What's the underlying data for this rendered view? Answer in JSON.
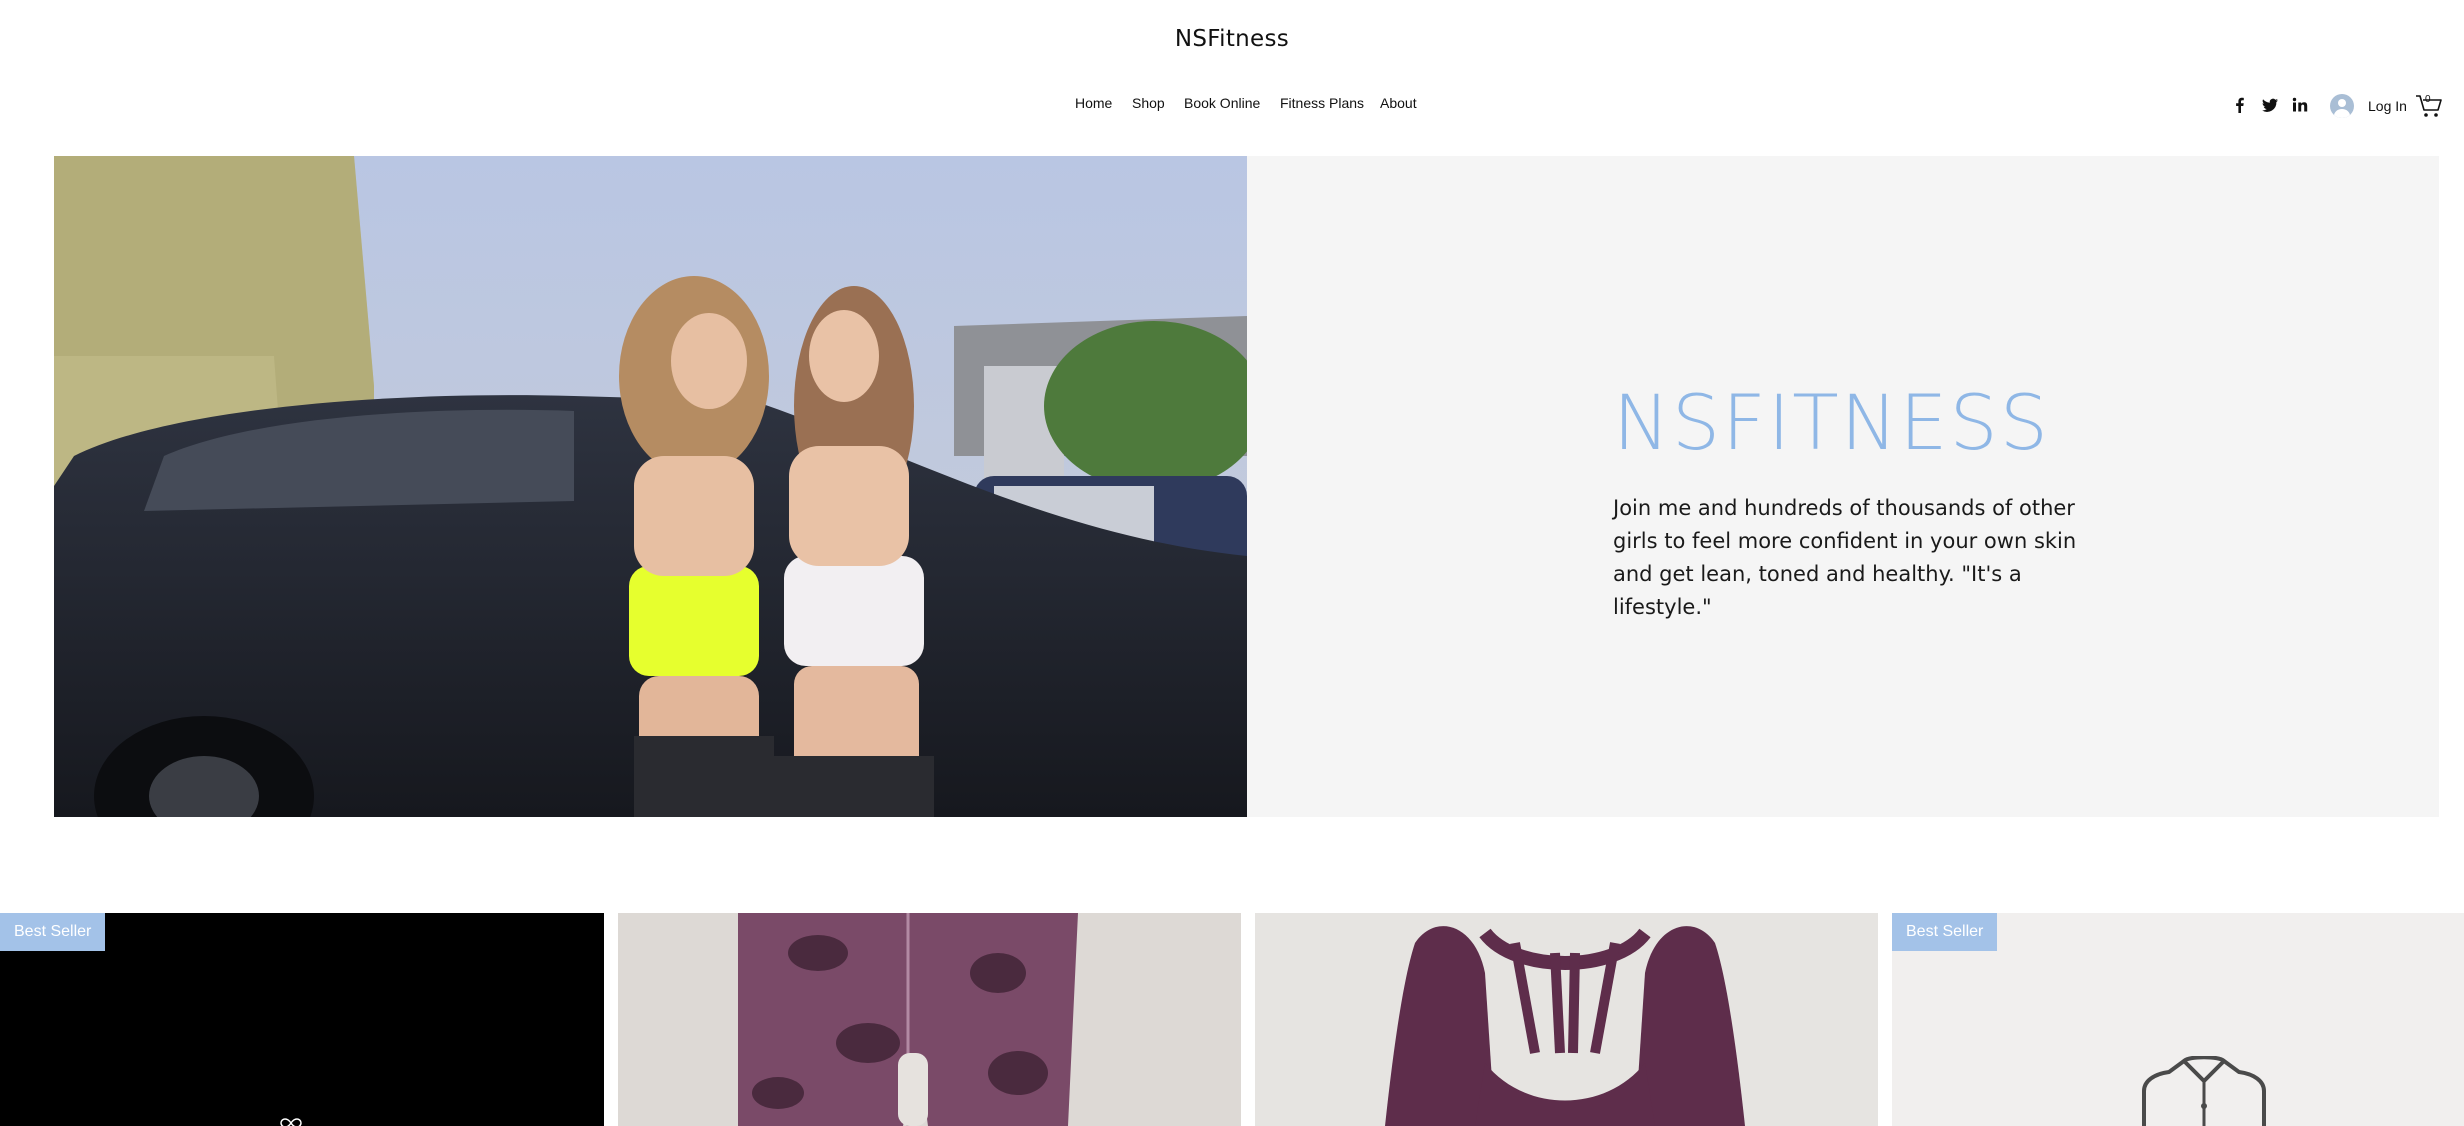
{
  "site": {
    "title": "NSFitness"
  },
  "nav": {
    "items": [
      {
        "label": "Home"
      },
      {
        "label": "Shop"
      },
      {
        "label": "Book Online"
      },
      {
        "label": "Fitness Plans"
      },
      {
        "label": "About"
      }
    ]
  },
  "social": [
    "facebook-icon",
    "twitter-icon",
    "linkedin-icon"
  ],
  "account": {
    "login_label": "Log In"
  },
  "cart": {
    "count": "0"
  },
  "hero": {
    "title": "NSFITNESS",
    "text": "Join me and hundreds of thousands of other girls to feel more confident in your own skin and get lean, toned and healthy. \"It's a lifestyle.\""
  },
  "products": [
    {
      "badge": "Best Seller"
    },
    {
      "badge": ""
    },
    {
      "badge": ""
    },
    {
      "badge": "Best Seller"
    }
  ],
  "colors": {
    "accent": "#8fb7e6",
    "badge": "#a3c2e8",
    "panel": "#f5f5f5"
  }
}
